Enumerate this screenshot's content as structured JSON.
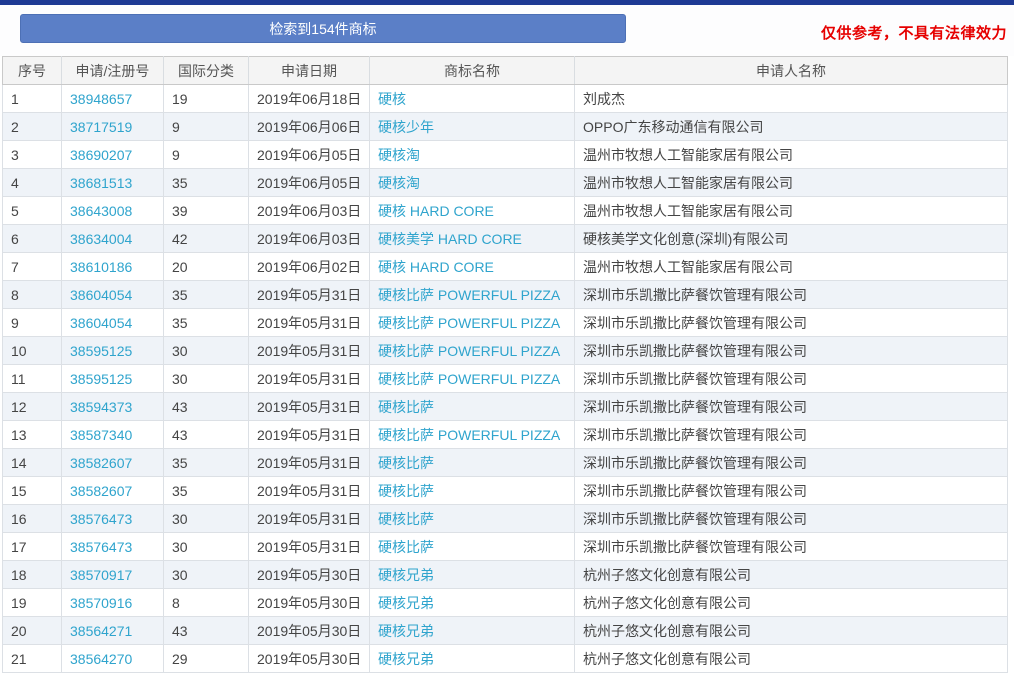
{
  "banner": {
    "count_label": "检索到154件商标",
    "disclaimer": "仅供参考，不具有法律效力"
  },
  "table": {
    "headers": [
      "序号",
      "申请/注册号",
      "国际分类",
      "申请日期",
      "商标名称",
      "申请人名称"
    ],
    "rows": [
      {
        "no": "1",
        "reg_no": "38948657",
        "intl_class": "19",
        "date": "2019年06月18日",
        "name": "硬核",
        "applicant": "刘成杰"
      },
      {
        "no": "2",
        "reg_no": "38717519",
        "intl_class": "9",
        "date": "2019年06月06日",
        "name": "硬核少年",
        "applicant": "OPPO广东移动通信有限公司"
      },
      {
        "no": "3",
        "reg_no": "38690207",
        "intl_class": "9",
        "date": "2019年06月05日",
        "name": "硬核淘",
        "applicant": "温州市牧想人工智能家居有限公司"
      },
      {
        "no": "4",
        "reg_no": "38681513",
        "intl_class": "35",
        "date": "2019年06月05日",
        "name": "硬核淘",
        "applicant": "温州市牧想人工智能家居有限公司"
      },
      {
        "no": "5",
        "reg_no": "38643008",
        "intl_class": "39",
        "date": "2019年06月03日",
        "name": "硬核 HARD CORE",
        "applicant": "温州市牧想人工智能家居有限公司"
      },
      {
        "no": "6",
        "reg_no": "38634004",
        "intl_class": "42",
        "date": "2019年06月03日",
        "name": "硬核美学 HARD CORE",
        "applicant": "硬核美学文化创意(深圳)有限公司"
      },
      {
        "no": "7",
        "reg_no": "38610186",
        "intl_class": "20",
        "date": "2019年06月02日",
        "name": "硬核 HARD CORE",
        "applicant": "温州市牧想人工智能家居有限公司"
      },
      {
        "no": "8",
        "reg_no": "38604054",
        "intl_class": "35",
        "date": "2019年05月31日",
        "name": "硬核比萨 POWERFUL PIZZA",
        "applicant": "深圳市乐凯撒比萨餐饮管理有限公司"
      },
      {
        "no": "9",
        "reg_no": "38604054",
        "intl_class": "35",
        "date": "2019年05月31日",
        "name": "硬核比萨 POWERFUL PIZZA",
        "applicant": "深圳市乐凯撒比萨餐饮管理有限公司"
      },
      {
        "no": "10",
        "reg_no": "38595125",
        "intl_class": "30",
        "date": "2019年05月31日",
        "name": "硬核比萨 POWERFUL PIZZA",
        "applicant": "深圳市乐凯撒比萨餐饮管理有限公司"
      },
      {
        "no": "11",
        "reg_no": "38595125",
        "intl_class": "30",
        "date": "2019年05月31日",
        "name": "硬核比萨 POWERFUL PIZZA",
        "applicant": "深圳市乐凯撒比萨餐饮管理有限公司"
      },
      {
        "no": "12",
        "reg_no": "38594373",
        "intl_class": "43",
        "date": "2019年05月31日",
        "name": "硬核比萨",
        "applicant": "深圳市乐凯撒比萨餐饮管理有限公司"
      },
      {
        "no": "13",
        "reg_no": "38587340",
        "intl_class": "43",
        "date": "2019年05月31日",
        "name": "硬核比萨 POWERFUL PIZZA",
        "applicant": "深圳市乐凯撒比萨餐饮管理有限公司"
      },
      {
        "no": "14",
        "reg_no": "38582607",
        "intl_class": "35",
        "date": "2019年05月31日",
        "name": "硬核比萨",
        "applicant": "深圳市乐凯撒比萨餐饮管理有限公司"
      },
      {
        "no": "15",
        "reg_no": "38582607",
        "intl_class": "35",
        "date": "2019年05月31日",
        "name": "硬核比萨",
        "applicant": "深圳市乐凯撒比萨餐饮管理有限公司"
      },
      {
        "no": "16",
        "reg_no": "38576473",
        "intl_class": "30",
        "date": "2019年05月31日",
        "name": "硬核比萨",
        "applicant": "深圳市乐凯撒比萨餐饮管理有限公司"
      },
      {
        "no": "17",
        "reg_no": "38576473",
        "intl_class": "30",
        "date": "2019年05月31日",
        "name": "硬核比萨",
        "applicant": "深圳市乐凯撒比萨餐饮管理有限公司"
      },
      {
        "no": "18",
        "reg_no": "38570917",
        "intl_class": "30",
        "date": "2019年05月30日",
        "name": "硬核兄弟",
        "applicant": "杭州子悠文化创意有限公司"
      },
      {
        "no": "19",
        "reg_no": "38570916",
        "intl_class": "8",
        "date": "2019年05月30日",
        "name": "硬核兄弟",
        "applicant": "杭州子悠文化创意有限公司"
      },
      {
        "no": "20",
        "reg_no": "38564271",
        "intl_class": "43",
        "date": "2019年05月30日",
        "name": "硬核兄弟",
        "applicant": "杭州子悠文化创意有限公司"
      },
      {
        "no": "21",
        "reg_no": "38564270",
        "intl_class": "29",
        "date": "2019年05月30日",
        "name": "硬核兄弟",
        "applicant": "杭州子悠文化创意有限公司"
      }
    ]
  },
  "colors": {
    "topbar": "#1e3a94",
    "button_bg": "#5b7fc7",
    "link": "#2fa4cd",
    "disclaimer": "#e60000",
    "even_row_bg": "#eff3f8",
    "header_bg": "#f4f4f4"
  }
}
